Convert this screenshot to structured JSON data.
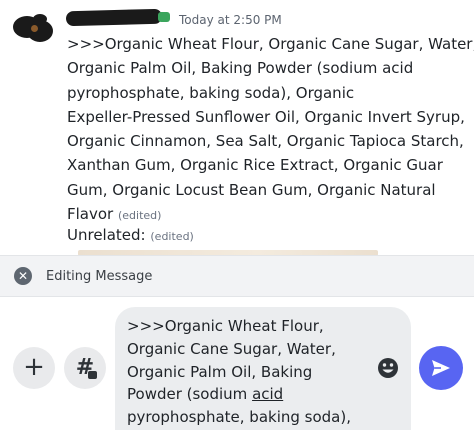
{
  "message": {
    "timestamp": "Today at 2:50 PM",
    "lines": [
      ">>>Organic Wheat Flour, Organic Cane Sugar, Water,",
      "Organic Palm Oil, Baking Powder (sodium acid",
      "pyrophosphate, baking soda), Organic",
      "Expeller-Pressed Sunflower Oil, Organic Invert Syrup,",
      "Organic Cinnamon, Sea Salt, Organic Tapioca Starch,",
      "Xanthan Gum, Organic Rice Extract, Organic Guar",
      "Gum, Organic Locust Bean Gum, Organic Natural",
      "Flavor"
    ],
    "edited_tag": "(edited)"
  },
  "message2": {
    "text": "Unrelated:",
    "edited_tag": "(edited)"
  },
  "editing_bar": {
    "label": "Editing Message",
    "close_glyph": "✕"
  },
  "composer": {
    "plus_glyph": "+",
    "thread_glyph": "#",
    "lines": [
      ">>>Organic Wheat Flour,",
      "Organic Cane Sugar, Water,",
      "Organic Palm Oil, Baking",
      "Powder (sodium ",
      "pyrophosphate, baking soda),"
    ],
    "underlined_word": "acid"
  },
  "colors": {
    "send_button": "#5865f2",
    "editing_bar_bg": "#f2f3f5",
    "input_bg": "#ebedef"
  }
}
